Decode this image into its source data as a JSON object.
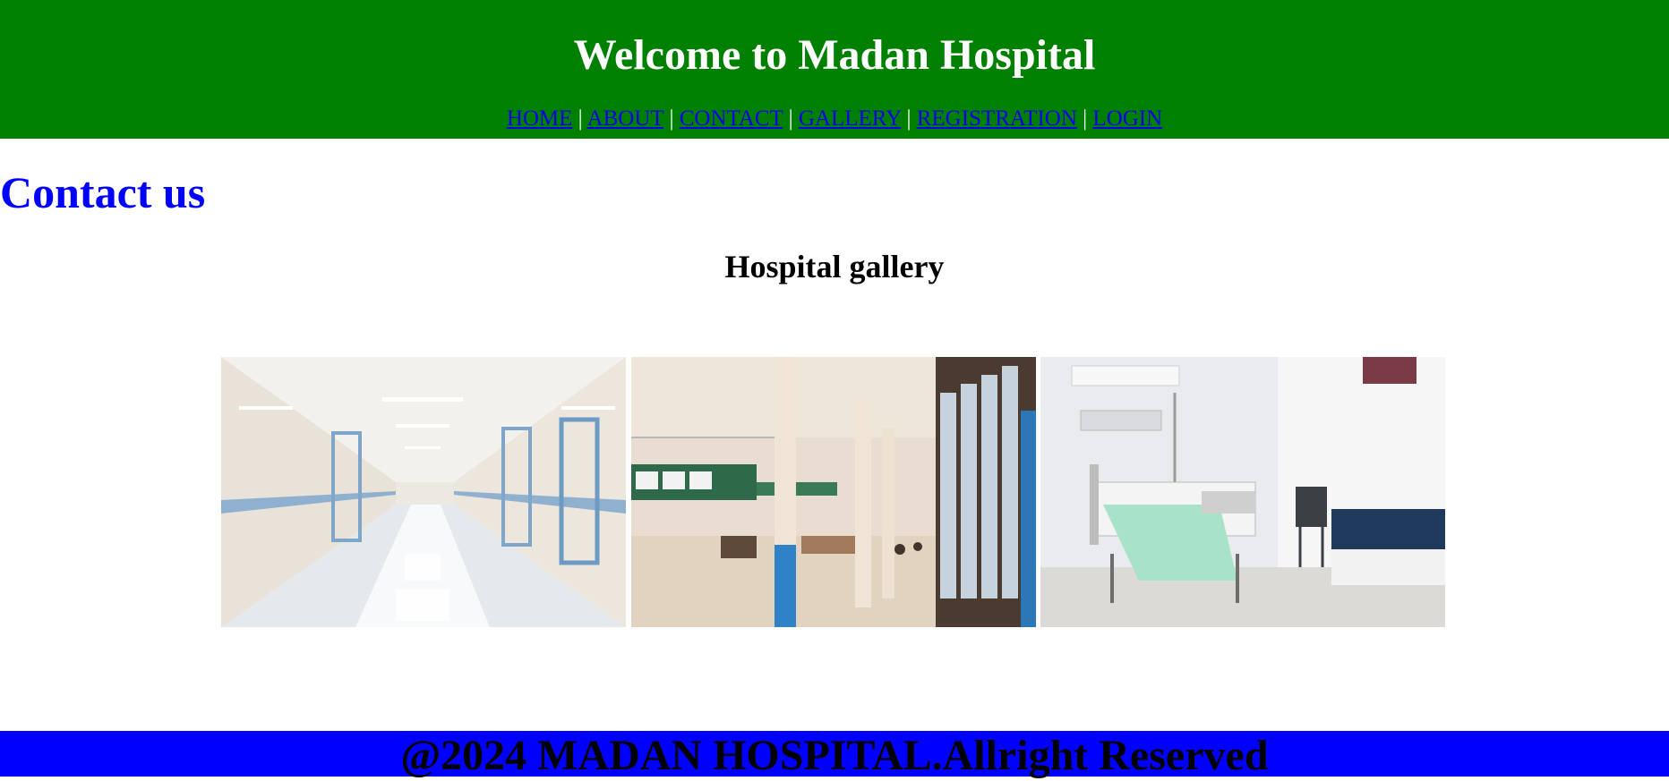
{
  "header": {
    "title": "Welcome to Madan Hospital",
    "bg_color": "#008000"
  },
  "nav": {
    "items": [
      {
        "label": "HOME"
      },
      {
        "label": "ABOUT"
      },
      {
        "label": "CONTACT"
      },
      {
        "label": "GALLERY"
      },
      {
        "label": "REGISTRATION"
      },
      {
        "label": "LOGIN"
      }
    ],
    "separator": "|",
    "link_color": "#0000ee"
  },
  "main": {
    "heading": "Contact us",
    "heading_color": "#0000ff",
    "gallery_heading": "Hospital gallery",
    "images": [
      {
        "alt": "hospital-corridor-photo"
      },
      {
        "alt": "hospital-lobby-photo"
      },
      {
        "alt": "hospital-ward-bed-photo"
      }
    ]
  },
  "footer": {
    "text": "@2024 MADAN HOSPITAL.Allright Reserved",
    "bg_color": "#0000ff"
  }
}
